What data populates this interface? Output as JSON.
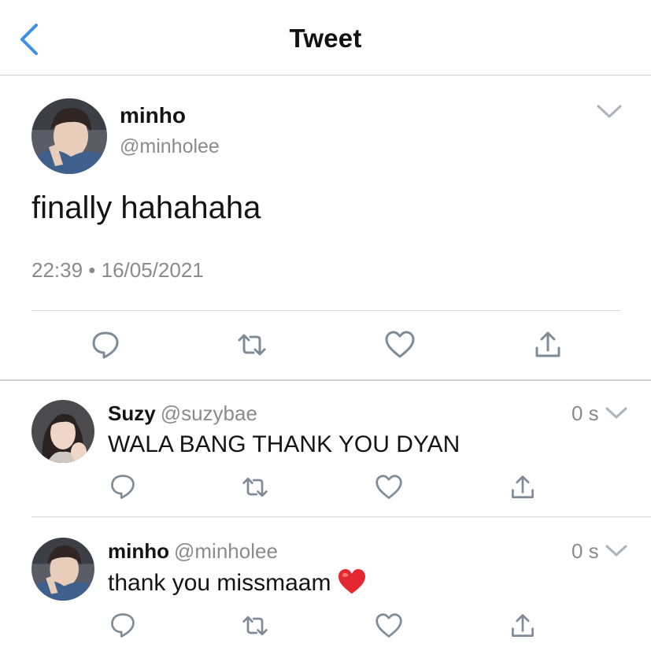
{
  "header": {
    "title": "Tweet",
    "back_icon": "chevron-left-icon"
  },
  "main_tweet": {
    "name": "minho",
    "handle": "@minholee",
    "text": "finally hahahaha",
    "timestamp": "22:39 • 16/05/2021",
    "actions": [
      "reply-icon",
      "retweet-icon",
      "like-icon",
      "share-icon"
    ]
  },
  "replies": [
    {
      "name": "Suzy",
      "handle": "@suzybae",
      "text": "WALA BANG THANK YOU DYAN",
      "time": "0 s"
    },
    {
      "name": "minho",
      "handle": "@minholee",
      "text": "thank you missmaam",
      "time": "0 s",
      "emoji": "red-heart-emoji"
    }
  ],
  "colors": {
    "accent": "#1da1f2",
    "icon_gray": "#8899a6",
    "meta_gray": "#8a8a8f",
    "text": "#141414"
  }
}
